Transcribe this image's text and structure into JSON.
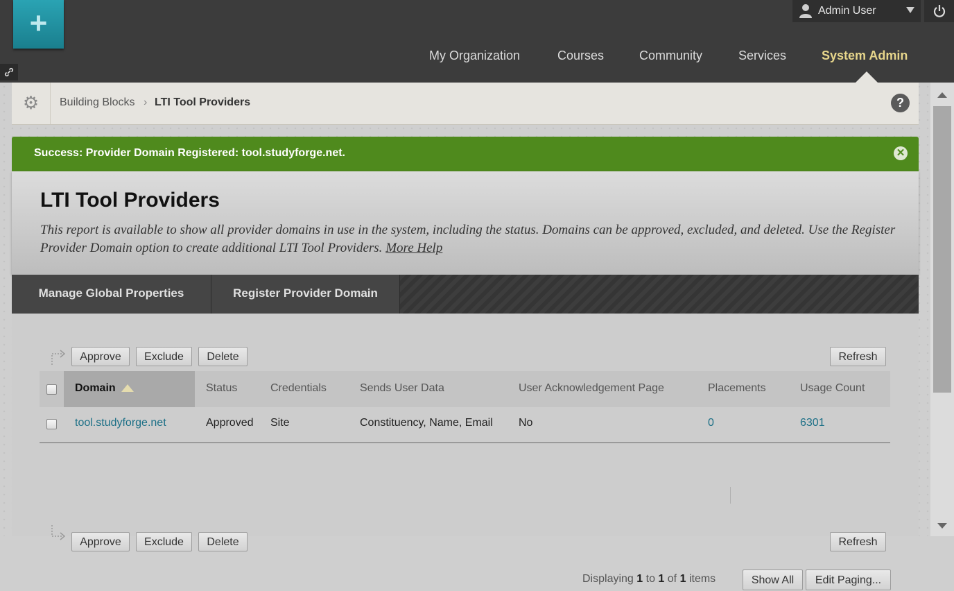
{
  "header": {
    "user": {
      "name": "Admin User"
    },
    "nav": [
      {
        "label": "My Organization",
        "active": false
      },
      {
        "label": "Courses",
        "active": false
      },
      {
        "label": "Community",
        "active": false
      },
      {
        "label": "Services",
        "active": false
      },
      {
        "label": "System Admin",
        "active": true
      }
    ],
    "icons": {
      "add": "plus-icon",
      "link": "link-icon",
      "user": "user-icon",
      "dropdown": "caret-down-icon",
      "power": "power-icon"
    }
  },
  "breadcrumb": {
    "parent": "Building Blocks",
    "separator": "›",
    "current": "LTI Tool Providers",
    "help_label": "?"
  },
  "alert": {
    "type": "success",
    "message": "Success: Provider Domain Registered: tool.studyforge.net.",
    "color": "#4f8a1d"
  },
  "page": {
    "title": "LTI Tool Providers",
    "description": "This report is available to show all provider domains in use in the system, including the status. Domains can be approved, excluded, and deleted. Use the Register Provider Domain option to create additional LTI Tool Providers.",
    "more_help": "More Help"
  },
  "actions": {
    "manage": "Manage Global Properties",
    "register": "Register Provider Domain"
  },
  "list_actions": {
    "approve": "Approve",
    "exclude": "Exclude",
    "delete": "Delete",
    "refresh": "Refresh"
  },
  "table": {
    "columns": [
      {
        "label": "Domain",
        "sorted": "ascending"
      },
      {
        "label": "Status"
      },
      {
        "label": "Credentials"
      },
      {
        "label": "Sends User Data"
      },
      {
        "label": "User Acknowledgement Page"
      },
      {
        "label": "Placements"
      },
      {
        "label": "Usage Count"
      }
    ],
    "rows": [
      {
        "domain": "tool.studyforge.net",
        "status": "Approved",
        "credentials": "Site",
        "sends_user_data": "Constituency, Name, Email",
        "user_ack_page": "No",
        "placements": "0",
        "usage_count": "6301"
      }
    ]
  },
  "paging": {
    "prefix": "Displaying",
    "from": "1",
    "to_word": "to",
    "to": "1",
    "of_word": "of",
    "total": "1",
    "suffix": "items",
    "show_all": "Show All",
    "edit_paging": "Edit Paging..."
  },
  "colors": {
    "accent": "#e7d68b",
    "link": "#1b6f86",
    "header_bg": "#3c3c3c"
  }
}
